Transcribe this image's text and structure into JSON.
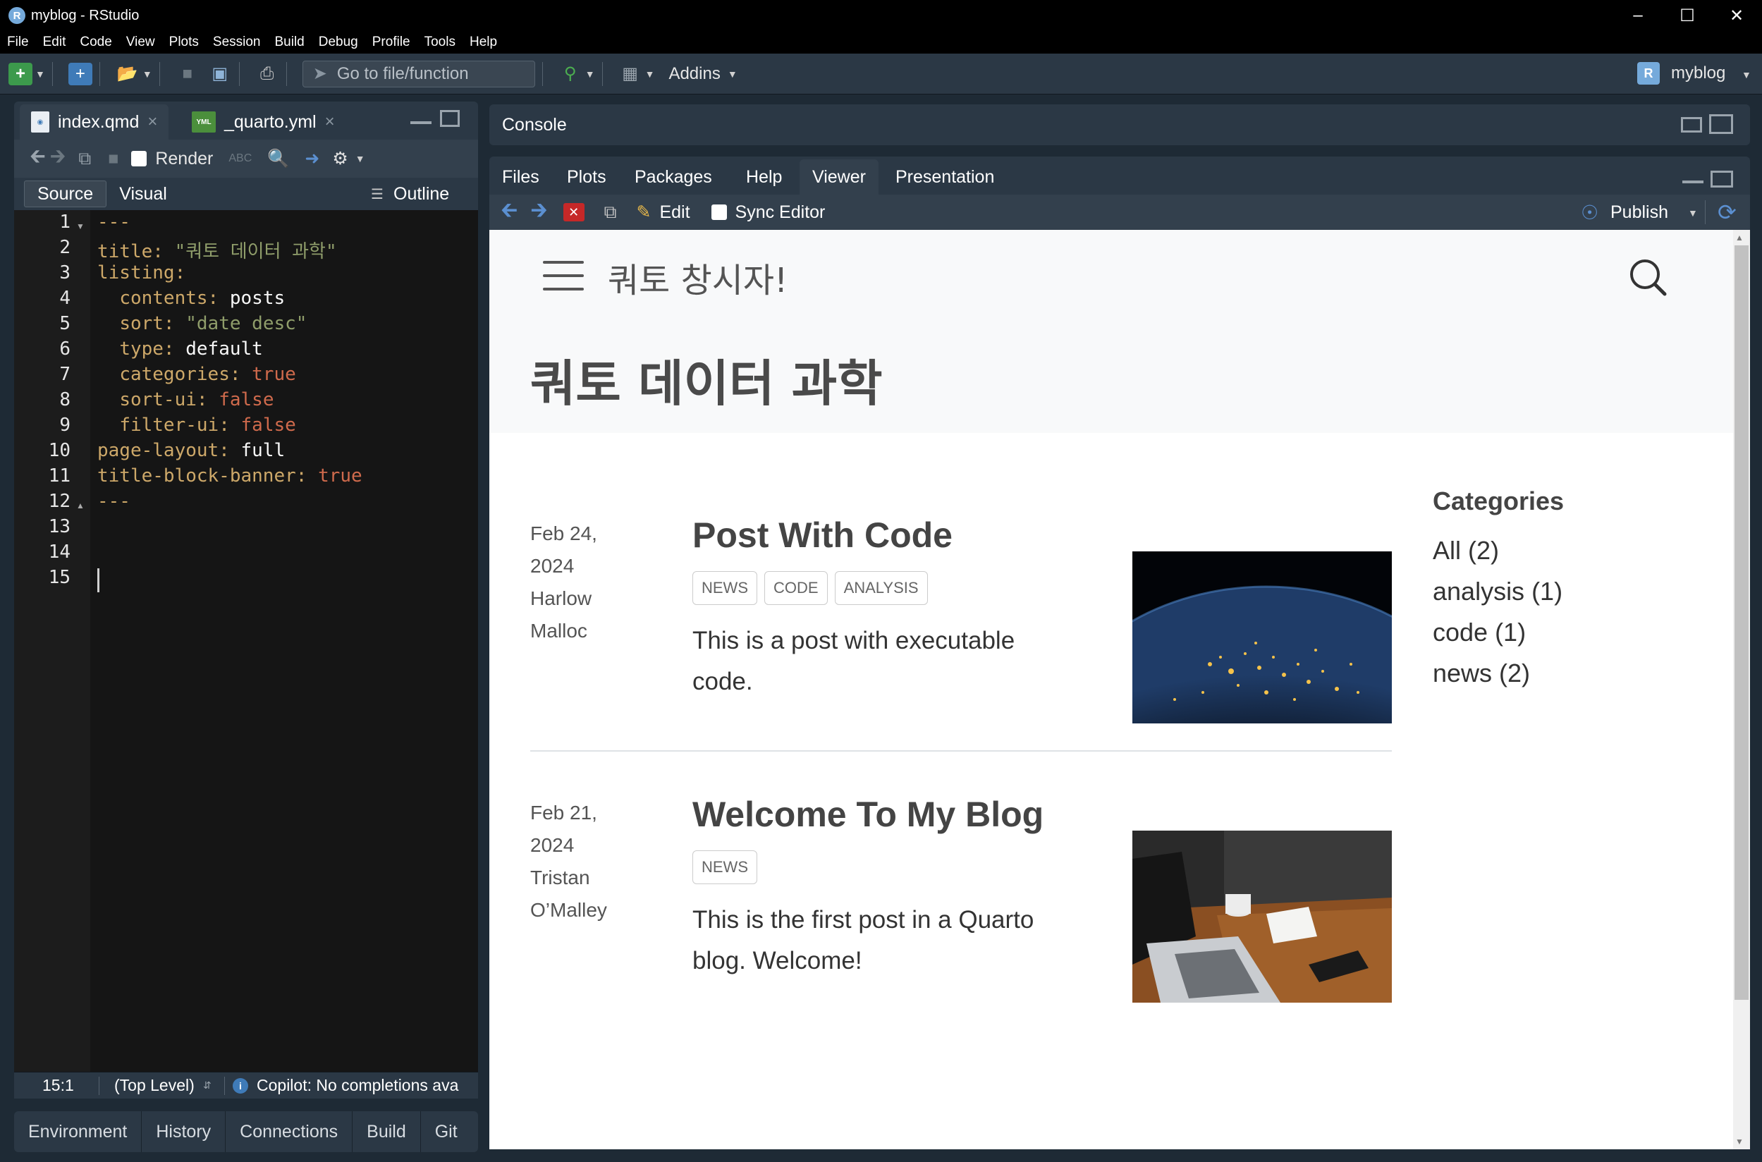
{
  "window": {
    "title": "myblog - RStudio",
    "logo": "R"
  },
  "menu": [
    "File",
    "Edit",
    "Code",
    "View",
    "Plots",
    "Session",
    "Build",
    "Debug",
    "Profile",
    "Tools",
    "Help"
  ],
  "toolbar": {
    "goto_placeholder": "Go to file/function",
    "addins": "Addins",
    "project": "myblog"
  },
  "editor": {
    "tabs": [
      {
        "label": "index.qmd",
        "icon": "qmd-file-icon"
      },
      {
        "label": "_quarto.yml",
        "icon": "yml-file-icon",
        "badge": "YML"
      }
    ],
    "render_label": "Render",
    "mode_source": "Source",
    "mode_visual": "Visual",
    "outline_label": "Outline",
    "line_numbers": [
      "1",
      "2",
      "3",
      "4",
      "5",
      "6",
      "7",
      "8",
      "9",
      "10",
      "11",
      "12",
      "13",
      "14",
      "15"
    ],
    "status": {
      "position": "15:1",
      "scope": "(Top Level)",
      "copilot": "Copilot: No completions ava"
    }
  },
  "bottom_tabs": [
    "Environment",
    "History",
    "Connections",
    "Build",
    "Git"
  ],
  "console": {
    "label": "Console"
  },
  "right_tabs": [
    "Files",
    "Plots",
    "Packages",
    "Help",
    "Viewer",
    "Presentation"
  ],
  "viewer_toolbar": {
    "edit": "Edit",
    "sync": "Sync Editor",
    "publish": "Publish"
  },
  "site": {
    "nav_title": "쿼토 창시자!",
    "page_title": "쿼토 데이터 과학",
    "posts": [
      {
        "date_line1": "Feb 24,",
        "date_line2": "2024",
        "author_line1": "Harlow",
        "author_line2": "Malloc",
        "title": "Post With Code",
        "tags": [
          "NEWS",
          "CODE",
          "ANALYSIS"
        ],
        "desc_line1": "This is a post with executable",
        "desc_line2": "code.",
        "image": "earth-night-image"
      },
      {
        "date_line1": "Feb 21,",
        "date_line2": "2024",
        "author_line1": "Tristan",
        "author_line2": "O’Malley",
        "title": "Welcome To My Blog",
        "tags": [
          "NEWS"
        ],
        "desc_line1": "This is the first post in a Quarto",
        "desc_line2": "blog. Welcome!",
        "image": "laptop-desk-image"
      }
    ],
    "categories_title": "Categories",
    "categories": [
      "All (2)",
      "analysis (1)",
      "code (1)",
      "news (2)"
    ]
  }
}
